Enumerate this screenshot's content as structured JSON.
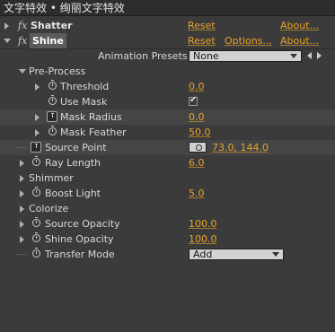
{
  "window": {
    "title": "文字特效 • 绚丽文字特效"
  },
  "effects": [
    {
      "fx": "fx",
      "name": "Shatter",
      "reset": "Reset",
      "about": "About..."
    },
    {
      "fx": "fx",
      "name": "Shine",
      "reset": "Reset",
      "options": "Options...",
      "about": "About..."
    }
  ],
  "presets": {
    "label": "Animation Presets:",
    "value": "None"
  },
  "groups": {
    "preprocess": "Pre-Process",
    "shimmer": "Shimmer",
    "colorize": "Colorize"
  },
  "params": {
    "threshold": {
      "label": "Threshold",
      "value": "0.0"
    },
    "use_mask": {
      "label": "Use Mask",
      "checked": "✔"
    },
    "mask_radius": {
      "label": "Mask Radius",
      "value": "0.0"
    },
    "mask_feather": {
      "label": "Mask Feather",
      "value": "50.0"
    },
    "source_point": {
      "label": "Source Point",
      "value": "73.0, 144.0"
    },
    "ray_length": {
      "label": "Ray Length",
      "value": "6.0"
    },
    "boost_light": {
      "label": "Boost Light",
      "value": "5.0"
    },
    "source_opacity": {
      "label": "Source Opacity",
      "value": "100.0"
    },
    "shine_opacity": {
      "label": "Shine Opacity",
      "value": "100.0"
    },
    "transfer_mode": {
      "label": "Transfer Mode",
      "value": "Add"
    }
  },
  "colors": {
    "value_accent": "#e9a32a",
    "panel_bg": "#3b3b3b"
  }
}
